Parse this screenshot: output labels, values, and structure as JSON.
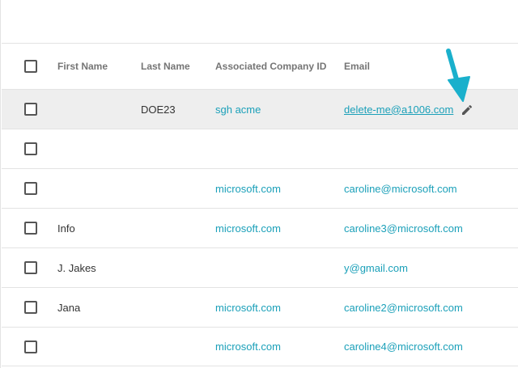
{
  "columns": {
    "first_name": "First Name",
    "last_name": "Last Name",
    "company_id": "Associated Company ID",
    "email": "Email"
  },
  "rows": [
    {
      "first_name": "",
      "last_name": "DOE23",
      "company_id": "sgh acme",
      "email": "delete-me@a1006.com"
    },
    {
      "first_name": "",
      "last_name": "",
      "company_id": "",
      "email": ""
    },
    {
      "first_name": "",
      "last_name": "",
      "company_id": "microsoft.com",
      "email": "caroline@microsoft.com"
    },
    {
      "first_name": "Info",
      "last_name": "",
      "company_id": "microsoft.com",
      "email": "caroline3@microsoft.com"
    },
    {
      "first_name": "J. Jakes",
      "last_name": "",
      "company_id": "",
      "email": "y@gmail.com"
    },
    {
      "first_name": "Jana",
      "last_name": "",
      "company_id": "microsoft.com",
      "email": "caroline2@microsoft.com"
    },
    {
      "first_name": "",
      "last_name": "",
      "company_id": "microsoft.com",
      "email": "caroline4@microsoft.com"
    }
  ],
  "icons": {
    "edit": "pencil-icon",
    "annotation": "arrow-annotation-icon"
  },
  "colors": {
    "link": "#1ba0b9",
    "arrow": "#1ab0cc",
    "highlight_row": "#eeeeee"
  }
}
